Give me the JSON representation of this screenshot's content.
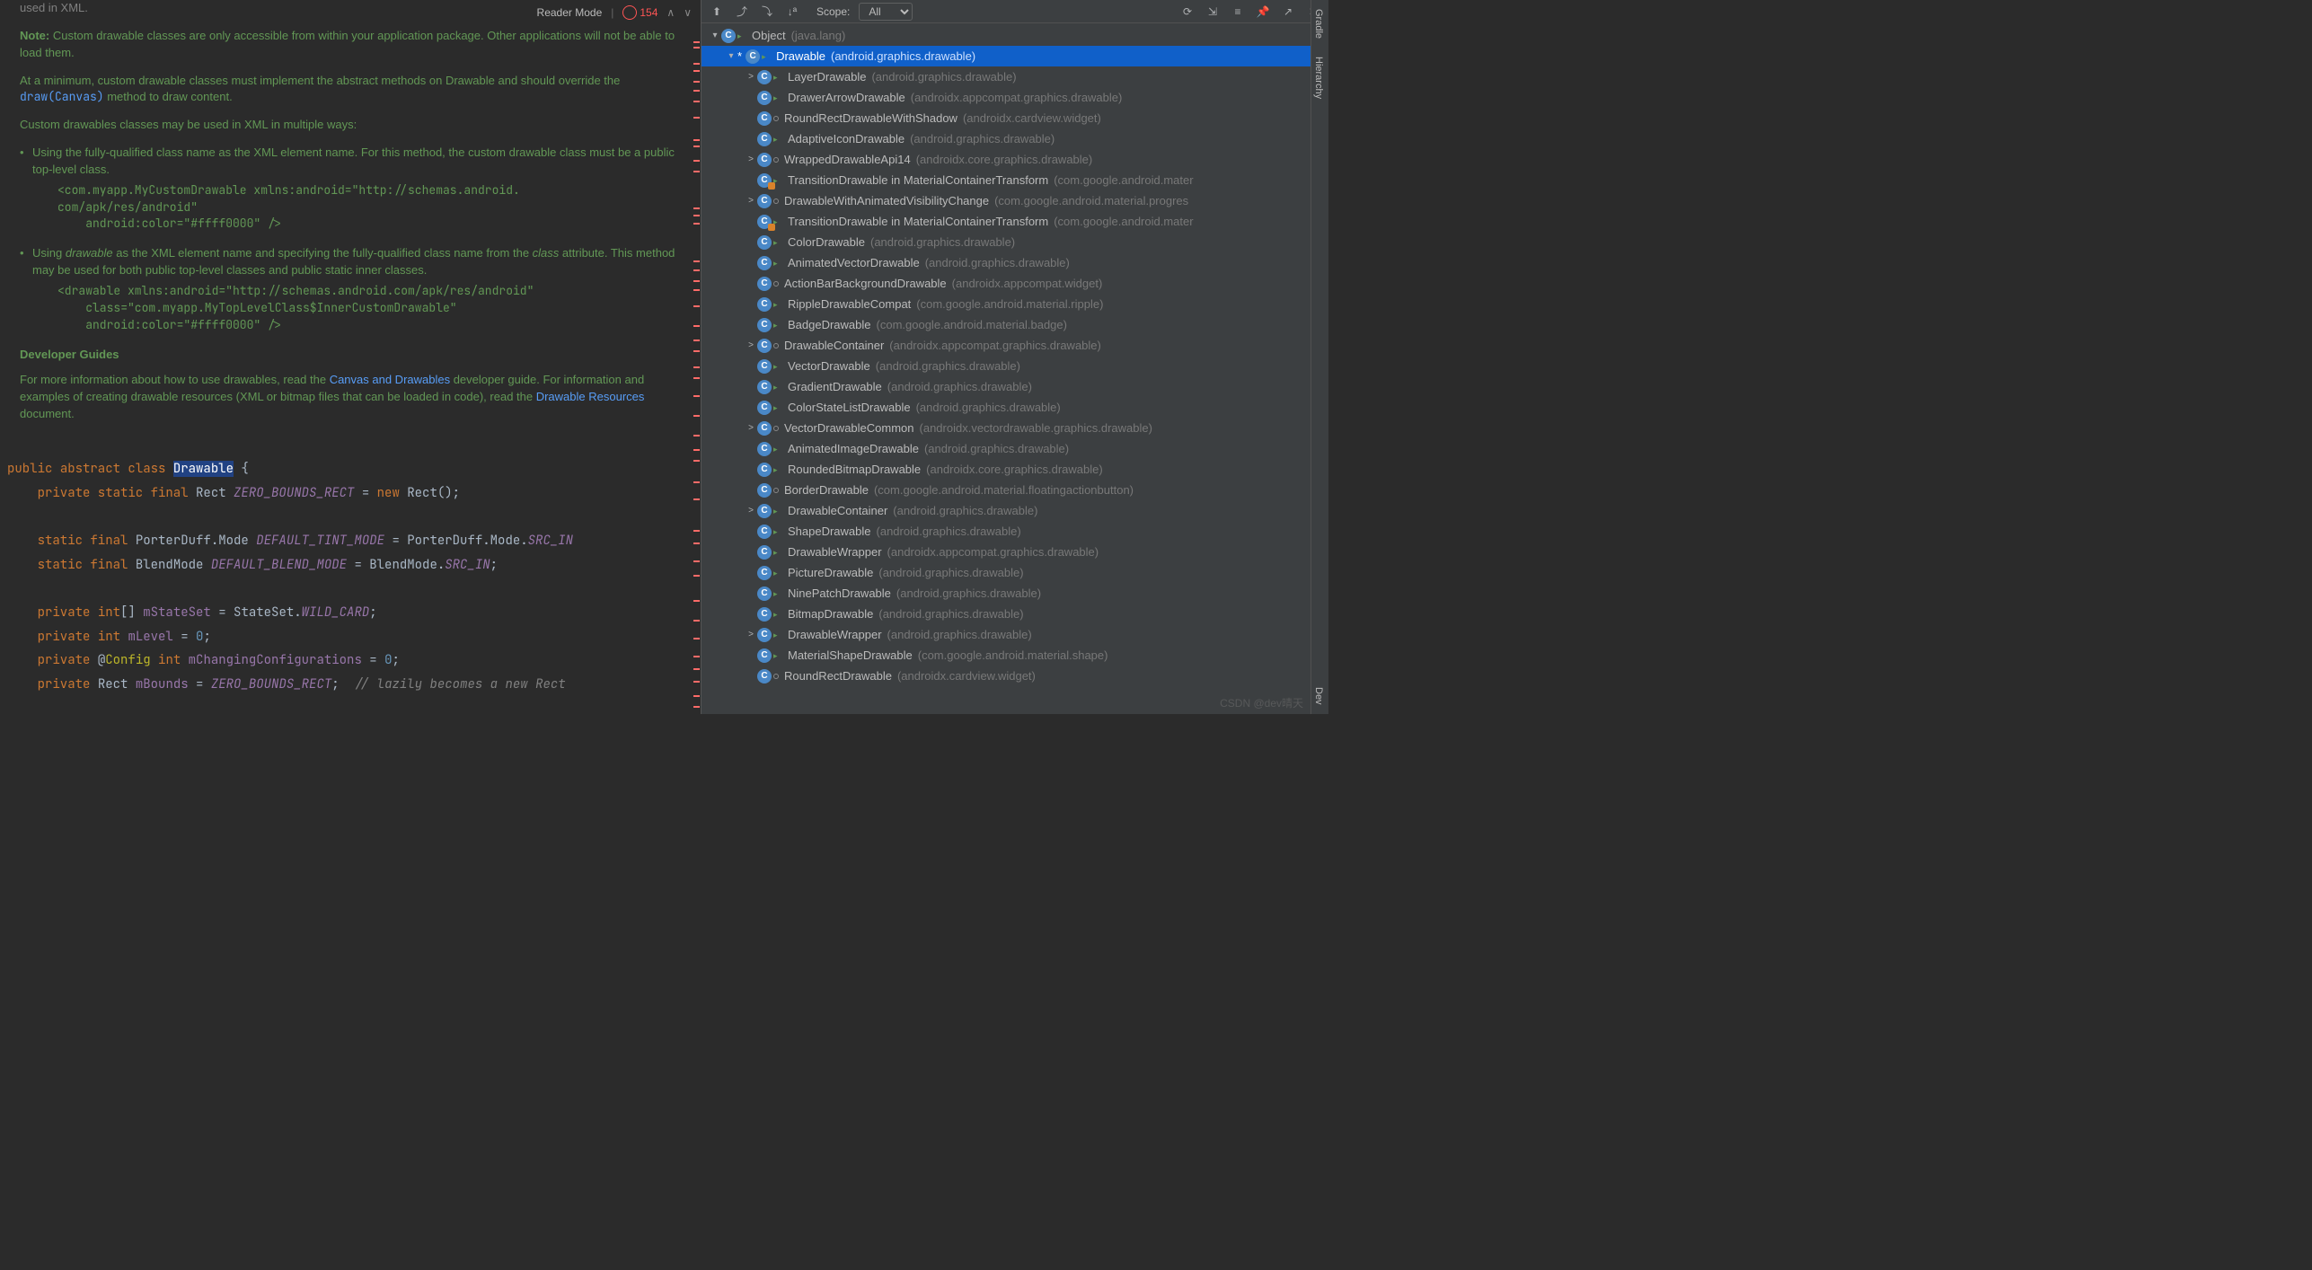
{
  "toolbar": {
    "reader_mode": "Reader Mode",
    "error_count": "154"
  },
  "doc": {
    "used_xml": "used in XML.",
    "note_label": "Note:",
    "note_text": " Custom drawable classes are only accessible from within your application package. Other applications will not be able to load them.",
    "min_text_a": "At a minimum, custom drawable classes must implement the abstract methods on Drawable and should override the ",
    "draw_canvas": "draw(Canvas)",
    "min_text_b": " method to draw content.",
    "custom_ways": "Custom drawables classes may be used in XML in multiple ways:",
    "li1": "Using the fully-qualified class name as the XML element name. For this method, the custom drawable class must be a public top-level class.",
    "code1": "<com.myapp.MyCustomDrawable xmlns:android=\"http://schemas.android.\ncom/apk/res/android\"\n    android:color=\"#ffff0000\" />",
    "li2a": "Using ",
    "li2_i1": "drawable",
    "li2b": " as the XML element name and specifying the fully-qualified class name from the ",
    "li2_i2": "class",
    "li2c": " attribute. This method may be used for both public top-level classes and public static inner classes.",
    "code2": "<drawable xmlns:android=\"http://schemas.android.com/apk/res/android\"\n    class=\"com.myapp.MyTopLevelClass$InnerCustomDrawable\"\n    android:color=\"#ffff0000\" />",
    "dev_guides": "Developer Guides",
    "more_a": "For more information about how to use drawables, read the ",
    "canvas_link": "Canvas and Drawables",
    "more_b": " developer guide. For information and examples of creating drawable resources (XML or bitmap files that can be loaded in code), read the ",
    "res_link": "Drawable Resources",
    "more_c": " document."
  },
  "code": {
    "l1_a": "public",
    "l1_b": "abstract",
    "l1_c": "class",
    "l1_d": "Drawable",
    "l1_e": " {",
    "l2_a": "private static final",
    "l2_b": "Rect",
    "l2_c": "ZERO_BOUNDS_RECT",
    "l2_d": " = ",
    "l2_e": "new",
    "l2_f": " Rect();",
    "l3_a": "static final",
    "l3_b": "PorterDuff.Mode",
    "l3_c": "DEFAULT_TINT_MODE",
    "l3_d": " = PorterDuff.Mode.",
    "l3_e": "SRC_IN",
    "l4_a": "static final",
    "l4_b": "BlendMode",
    "l4_c": "DEFAULT_BLEND_MODE",
    "l4_d": " = BlendMode.",
    "l4_e": "SRC_IN",
    "l4_f": ";",
    "l5_a": "private",
    "l5_b": "int",
    "l5_c": "[] ",
    "l5_d": "mStateSet",
    "l5_e": " = StateSet.",
    "l5_f": "WILD_CARD",
    "l5_g": ";",
    "l6_a": "private",
    "l6_b": "int",
    "l6_c": "mLevel",
    "l6_d": " = ",
    "l6_e": "0",
    "l6_f": ";",
    "l7_a": "private",
    "l7_b": " @",
    "l7_c": "Config",
    "l7_d": "int",
    "l7_e": "mChangingConfigurations",
    "l7_f": " = ",
    "l7_g": "0",
    "l7_h": ";",
    "l8_a": "private",
    "l8_b": "Rect",
    "l8_c": "mBounds",
    "l8_d": " = ",
    "l8_e": "ZERO_BOUNDS_RECT",
    "l8_f": ";",
    "l8_g": "  // lazily becomes a new Rect"
  },
  "hierarchy": {
    "scope_label": "Scope:",
    "scope_value": "All",
    "root": {
      "name": "Object",
      "pkg": "(java.lang)"
    },
    "selected": {
      "name": "Drawable",
      "pkg": "(android.graphics.drawable)"
    },
    "items": [
      {
        "arrow": ">",
        "name": "LayerDrawable",
        "pkg": "(android.graphics.drawable)"
      },
      {
        "arrow": "",
        "name": "DrawerArrowDrawable",
        "pkg": "(androidx.appcompat.graphics.drawable)"
      },
      {
        "arrow": "",
        "name": "RoundRectDrawableWithShadow",
        "pkg": "(androidx.cardview.widget)",
        "dot": true
      },
      {
        "arrow": "",
        "name": "AdaptiveIconDrawable",
        "pkg": "(android.graphics.drawable)"
      },
      {
        "arrow": ">",
        "name": "WrappedDrawableApi14",
        "pkg": "(androidx.core.graphics.drawable)",
        "dot": true
      },
      {
        "arrow": "",
        "name": "TransitionDrawable in MaterialContainerTransform",
        "pkg": "(com.google.android.mater",
        "locked": true
      },
      {
        "arrow": ">",
        "name": "DrawableWithAnimatedVisibilityChange",
        "pkg": "(com.google.android.material.progres",
        "dot": true
      },
      {
        "arrow": "",
        "name": "TransitionDrawable in MaterialContainerTransform",
        "pkg": "(com.google.android.mater",
        "locked": true
      },
      {
        "arrow": "",
        "name": "ColorDrawable",
        "pkg": "(android.graphics.drawable)"
      },
      {
        "arrow": "",
        "name": "AnimatedVectorDrawable",
        "pkg": "(android.graphics.drawable)"
      },
      {
        "arrow": "",
        "name": "ActionBarBackgroundDrawable",
        "pkg": "(androidx.appcompat.widget)",
        "dot": true
      },
      {
        "arrow": "",
        "name": "RippleDrawableCompat",
        "pkg": "(com.google.android.material.ripple)"
      },
      {
        "arrow": "",
        "name": "BadgeDrawable",
        "pkg": "(com.google.android.material.badge)"
      },
      {
        "arrow": ">",
        "name": "DrawableContainer",
        "pkg": "(androidx.appcompat.graphics.drawable)",
        "dot": true
      },
      {
        "arrow": "",
        "name": "VectorDrawable",
        "pkg": "(android.graphics.drawable)"
      },
      {
        "arrow": "",
        "name": "GradientDrawable",
        "pkg": "(android.graphics.drawable)"
      },
      {
        "arrow": "",
        "name": "ColorStateListDrawable",
        "pkg": "(android.graphics.drawable)"
      },
      {
        "arrow": ">",
        "name": "VectorDrawableCommon",
        "pkg": "(androidx.vectordrawable.graphics.drawable)",
        "dot": true
      },
      {
        "arrow": "",
        "name": "AnimatedImageDrawable",
        "pkg": "(android.graphics.drawable)"
      },
      {
        "arrow": "",
        "name": "RoundedBitmapDrawable",
        "pkg": "(androidx.core.graphics.drawable)"
      },
      {
        "arrow": "",
        "name": "BorderDrawable",
        "pkg": "(com.google.android.material.floatingactionbutton)",
        "dot": true
      },
      {
        "arrow": ">",
        "name": "DrawableContainer",
        "pkg": "(android.graphics.drawable)"
      },
      {
        "arrow": "",
        "name": "ShapeDrawable",
        "pkg": "(android.graphics.drawable)"
      },
      {
        "arrow": "",
        "name": "DrawableWrapper",
        "pkg": "(androidx.appcompat.graphics.drawable)"
      },
      {
        "arrow": "",
        "name": "PictureDrawable",
        "pkg": "(android.graphics.drawable)"
      },
      {
        "arrow": "",
        "name": "NinePatchDrawable",
        "pkg": "(android.graphics.drawable)"
      },
      {
        "arrow": "",
        "name": "BitmapDrawable",
        "pkg": "(android.graphics.drawable)"
      },
      {
        "arrow": ">",
        "name": "DrawableWrapper",
        "pkg": "(android.graphics.drawable)"
      },
      {
        "arrow": "",
        "name": "MaterialShapeDrawable",
        "pkg": "(com.google.android.material.shape)"
      },
      {
        "arrow": "",
        "name": "RoundRectDrawable",
        "pkg": "(androidx.cardview.widget)",
        "dot": true
      }
    ]
  },
  "right_tabs": {
    "gradle": "Gradle",
    "hierarchy": "Hierarchy",
    "device": "Dev"
  },
  "watermark": "CSDN @dev晴天"
}
